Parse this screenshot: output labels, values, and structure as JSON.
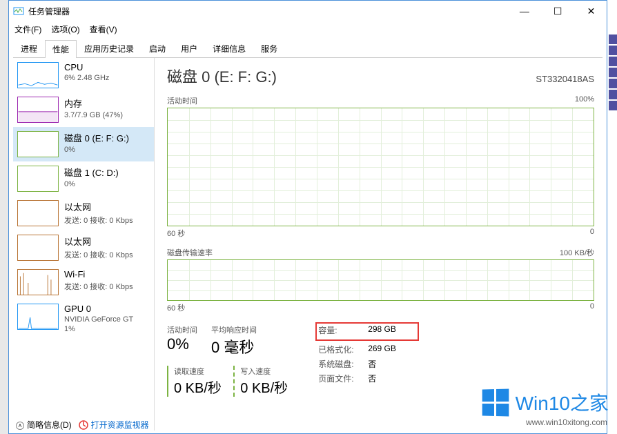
{
  "window": {
    "title": "任务管理器"
  },
  "menu": {
    "file": "文件(F)",
    "options": "选项(O)",
    "view": "查看(V)"
  },
  "tabs": [
    "进程",
    "性能",
    "应用历史记录",
    "启动",
    "用户",
    "详细信息",
    "服务"
  ],
  "sidebar": [
    {
      "name": "CPU",
      "detail": "6% 2.48 GHz",
      "color": "#2196f3"
    },
    {
      "name": "内存",
      "detail": "3.7/7.9 GB (47%)",
      "color": "#9c27b0"
    },
    {
      "name": "磁盘 0 (E: F: G:)",
      "detail": "0%",
      "color": "#7cb342"
    },
    {
      "name": "磁盘 1 (C: D:)",
      "detail": "0%",
      "color": "#7cb342"
    },
    {
      "name": "以太网",
      "detail": "发送: 0 接收: 0 Kbps",
      "color": "#b87333"
    },
    {
      "name": "以太网",
      "detail": "发送: 0 接收: 0 Kbps",
      "color": "#b87333"
    },
    {
      "name": "Wi-Fi",
      "detail": "发送: 0 接收: 0 Kbps",
      "color": "#b87333"
    },
    {
      "name": "GPU 0",
      "detail": "NVIDIA GeForce GT",
      "detail2": "1%",
      "color": "#2196f3"
    }
  ],
  "main": {
    "title": "磁盘 0 (E: F: G:)",
    "model": "ST3320418AS",
    "chart1": {
      "label": "活动时间",
      "max": "100%",
      "xleft": "60 秒",
      "xright": "0"
    },
    "chart2": {
      "label": "磁盘传输速率",
      "max": "100 KB/秒",
      "xleft": "60 秒",
      "xright": "0"
    },
    "stats": {
      "active_label": "活动时间",
      "active_value": "0%",
      "resp_label": "平均响应时间",
      "resp_value": "0 毫秒",
      "read_label": "读取速度",
      "read_value": "0 KB/秒",
      "write_label": "写入速度",
      "write_value": "0 KB/秒"
    },
    "info": {
      "capacity_k": "容量:",
      "capacity_v": "298 GB",
      "formatted_k": "已格式化:",
      "formatted_v": "269 GB",
      "system_k": "系统磁盘:",
      "system_v": "否",
      "pagefile_k": "页面文件:",
      "pagefile_v": "否"
    }
  },
  "footer": {
    "brief": "简略信息(D)",
    "resmon": "打开资源监视器"
  },
  "watermark": {
    "text": "Win10之家",
    "url": "www.win10xitong.com"
  },
  "chart_data": [
    {
      "type": "line",
      "title": "活动时间",
      "ylabel": "%",
      "ylim": [
        0,
        100
      ],
      "x_range_seconds": [
        60,
        0
      ],
      "series": [
        {
          "name": "活动时间",
          "values_approx": "flat near 0%"
        }
      ]
    },
    {
      "type": "line",
      "title": "磁盘传输速率",
      "ylabel": "KB/秒",
      "ylim": [
        0,
        100
      ],
      "x_range_seconds": [
        60,
        0
      ],
      "series": [
        {
          "name": "传输速率",
          "values_approx": "flat near 0"
        }
      ]
    }
  ]
}
